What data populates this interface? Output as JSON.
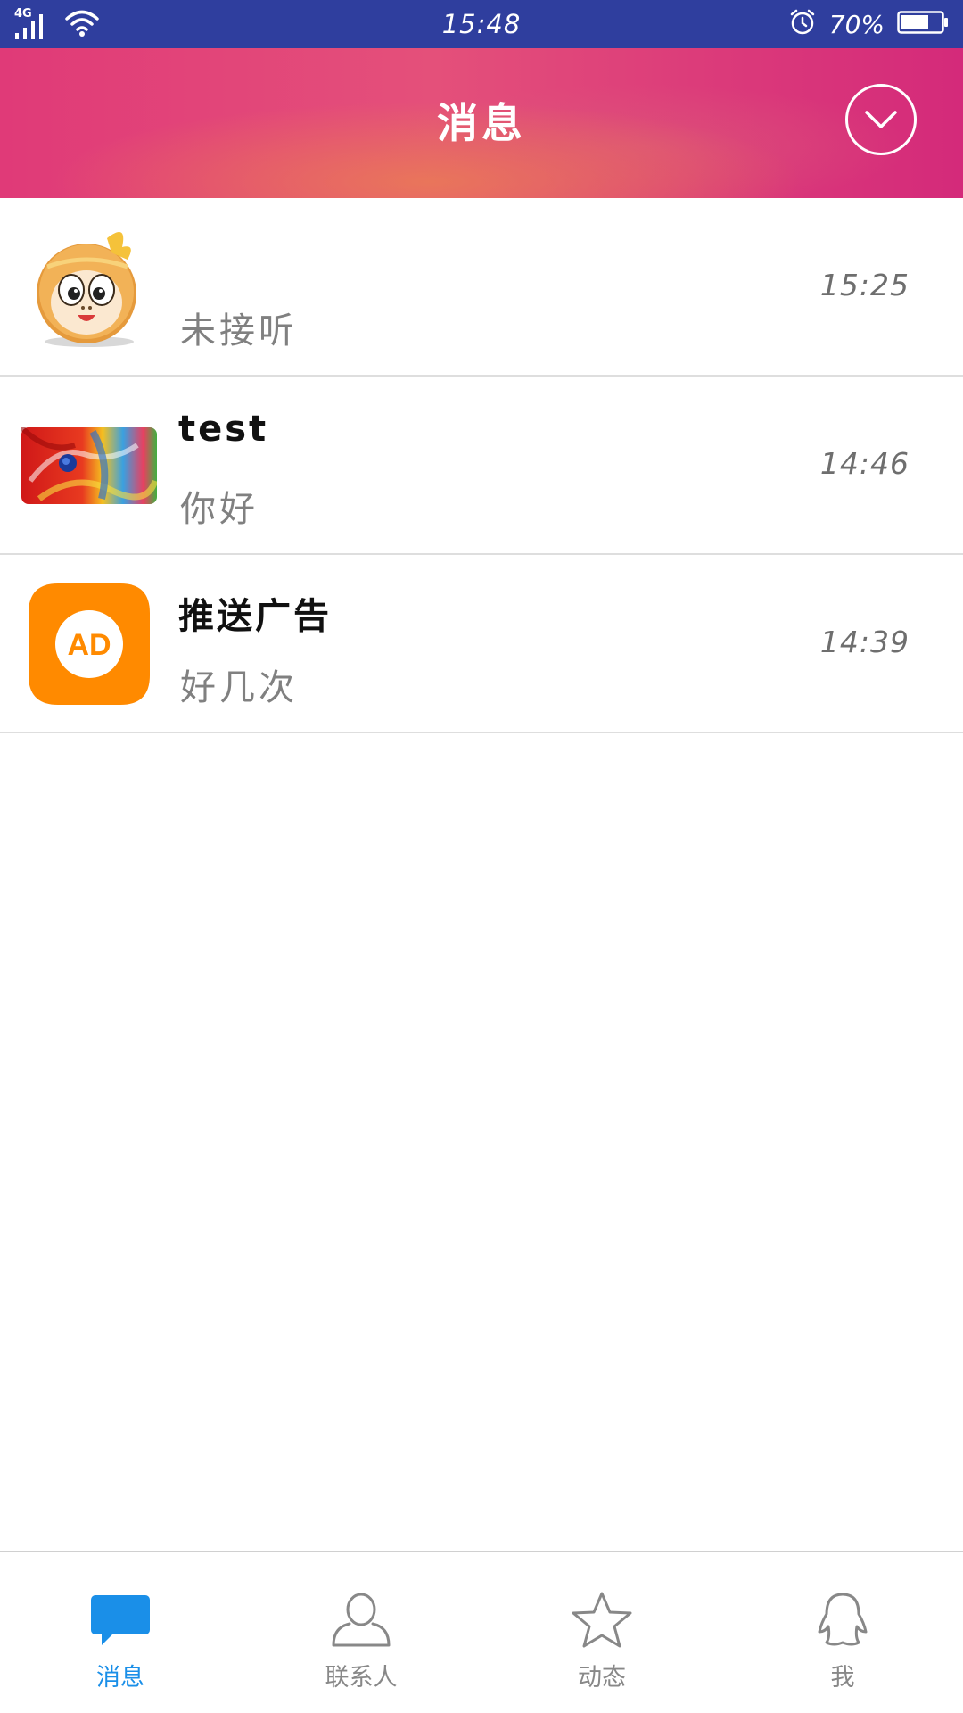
{
  "status_bar": {
    "network": "4G",
    "clock": "15:48",
    "battery_percent": "70%",
    "battery_level": 0.7
  },
  "header": {
    "title": "消息",
    "dropdown_icon": "chevron-down-circle-icon"
  },
  "conversations": [
    {
      "name": "",
      "preview": "未接听",
      "time": "15:25",
      "avatar": "monkey-cartoon-avatar"
    },
    {
      "name": "test",
      "preview": "你好",
      "time": "14:46",
      "avatar": "colorful-paint-avatar"
    },
    {
      "name": "推送广告",
      "preview": "好几次",
      "time": "14:39",
      "avatar": "ad-badge-avatar",
      "avatar_text": "AD"
    }
  ],
  "tabs": [
    {
      "label": "消息",
      "icon": "chat-bubble-icon",
      "active": true
    },
    {
      "label": "联系人",
      "icon": "person-icon",
      "active": false
    },
    {
      "label": "动态",
      "icon": "star-icon",
      "active": false
    },
    {
      "label": "我",
      "icon": "penguin-icon",
      "active": false
    }
  ],
  "colors": {
    "status_bar": "#2f3e9e",
    "header_start": "#e03a78",
    "header_end": "#d42a7a",
    "tab_active": "#1a8fe8",
    "tab_inactive": "#888888",
    "ad_orange": "#ff8a00"
  }
}
